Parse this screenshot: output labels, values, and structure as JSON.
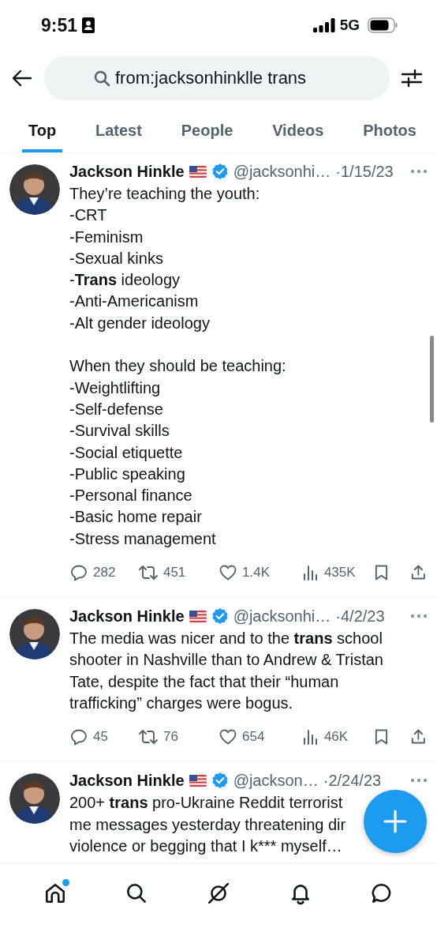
{
  "status_bar": {
    "time": "9:51",
    "network": "5G"
  },
  "search": {
    "value": "from:jacksonhinklle trans"
  },
  "tabs": [
    {
      "label": "Top",
      "selected": true
    },
    {
      "label": "Latest",
      "selected": false
    },
    {
      "label": "People",
      "selected": false
    },
    {
      "label": "Videos",
      "selected": false
    },
    {
      "label": "Photos",
      "selected": false
    }
  ],
  "tweets": [
    {
      "name": "Jackson Hinkle",
      "handle": "@jacksonhi…",
      "date": "·1/15/23",
      "paragraphs": [
        [
          "They’re teaching the youth:",
          "-CRT",
          "-Feminism",
          "-Sexual kinks",
          "-**Trans** ideology",
          "-Anti-Americanism",
          "-Alt gender ideology"
        ],
        [
          "When they should be teaching:",
          "-Weightlifting",
          "-Self-defense",
          "-Survival skills",
          "-Social etiquette",
          "-Public speaking",
          "-Personal finance",
          "-Basic home repair",
          "-Stress management"
        ]
      ],
      "actions": {
        "replies": "282",
        "reposts": "451",
        "likes": "1.4K",
        "views": "435K"
      }
    },
    {
      "name": "Jackson Hinkle",
      "handle": "@jacksonhi…",
      "date": "·4/2/23",
      "paragraphs": [
        [
          "The media was nicer and to the **trans** school",
          "shooter in Nashville than to Andrew & Tristan",
          "Tate, despite the fact that their “human",
          "trafficking” charges were bogus."
        ]
      ],
      "actions": {
        "replies": "45",
        "reposts": "76",
        "likes": "654",
        "views": "46K"
      }
    },
    {
      "name": "Jackson Hinkle",
      "handle": "@jackson…",
      "date": "·2/24/23",
      "paragraphs": [
        [
          "200+ **trans** pro-Ukraine Reddit terrorist",
          "me messages yesterday threatening dir",
          "violence or begging that I k*** myself…"
        ]
      ]
    }
  ],
  "nav": [
    {
      "kind": "home",
      "dot": true
    },
    {
      "kind": "search",
      "dot": false
    },
    {
      "kind": "grok",
      "dot": false
    },
    {
      "kind": "notifications",
      "dot": false
    },
    {
      "kind": "messages",
      "dot": false
    }
  ]
}
